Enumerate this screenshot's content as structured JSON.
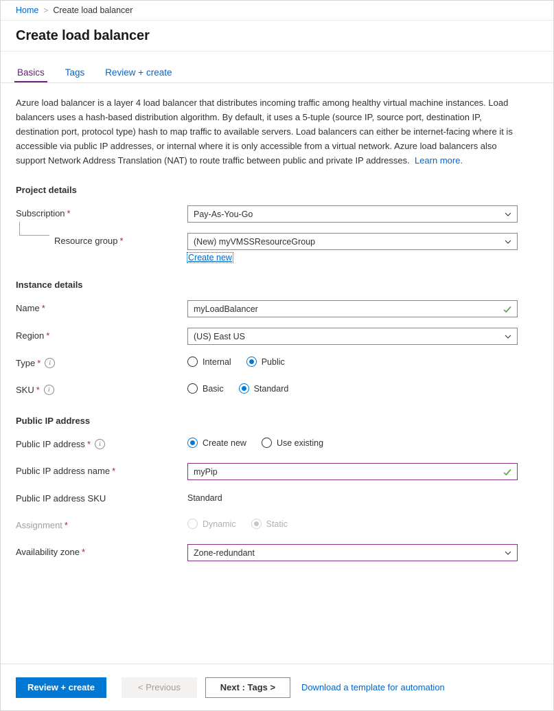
{
  "breadcrumb": {
    "home": "Home",
    "separator": ">",
    "current": "Create load balancer"
  },
  "header": {
    "title": "Create load balancer"
  },
  "tabs": [
    {
      "label": "Basics",
      "active": true
    },
    {
      "label": "Tags",
      "active": false
    },
    {
      "label": "Review + create",
      "active": false
    }
  ],
  "intro": {
    "text": "Azure load balancer is a layer 4 load balancer that distributes incoming traffic among healthy virtual machine instances. Load balancers uses a hash-based distribution algorithm. By default, it uses a 5-tuple (source IP, source port, destination IP, destination port, protocol type) hash to map traffic to available servers. Load balancers can either be internet-facing where it is accessible via public IP addresses, or internal where it is only accessible from a virtual network. Azure load balancers also support Network Address Translation (NAT) to route traffic between public and private IP addresses.",
    "learn_more": "Learn more."
  },
  "project_details": {
    "heading": "Project details",
    "subscription": {
      "label": "Subscription",
      "required": "*",
      "value": "Pay-As-You-Go"
    },
    "resource_group": {
      "label": "Resource group",
      "required": "*",
      "value": "(New) myVMSSResourceGroup",
      "create_new": "Create new"
    }
  },
  "instance_details": {
    "heading": "Instance details",
    "name": {
      "label": "Name",
      "required": "*",
      "value": "myLoadBalancer"
    },
    "region": {
      "label": "Region",
      "required": "*",
      "value": "(US) East US"
    },
    "type": {
      "label": "Type",
      "required": "*",
      "options": [
        {
          "label": "Internal",
          "selected": false
        },
        {
          "label": "Public",
          "selected": true
        }
      ]
    },
    "sku": {
      "label": "SKU",
      "required": "*",
      "options": [
        {
          "label": "Basic",
          "selected": false
        },
        {
          "label": "Standard",
          "selected": true
        }
      ]
    }
  },
  "public_ip": {
    "heading": "Public IP address",
    "address": {
      "label": "Public IP address",
      "required": "*",
      "options": [
        {
          "label": "Create new",
          "selected": true
        },
        {
          "label": "Use existing",
          "selected": false
        }
      ]
    },
    "address_name": {
      "label": "Public IP address name",
      "required": "*",
      "value": "myPip"
    },
    "address_sku": {
      "label": "Public IP address SKU",
      "value": "Standard"
    },
    "assignment": {
      "label": "Assignment",
      "required": "*",
      "options": [
        {
          "label": "Dynamic",
          "selected": false
        },
        {
          "label": "Static",
          "selected": true
        }
      ]
    },
    "availability_zone": {
      "label": "Availability zone",
      "required": "*",
      "value": "Zone-redundant"
    }
  },
  "footer": {
    "review_create": "Review + create",
    "previous": "< Previous",
    "next": "Next : Tags >",
    "download_template": "Download a template for automation"
  },
  "colors": {
    "accent_blue": "#0078d4",
    "link_blue": "#0066cc",
    "tab_purple": "#68217a",
    "focus_purple": "#8b2f8b",
    "required_red": "#a4262c",
    "valid_green": "#5faa46"
  }
}
